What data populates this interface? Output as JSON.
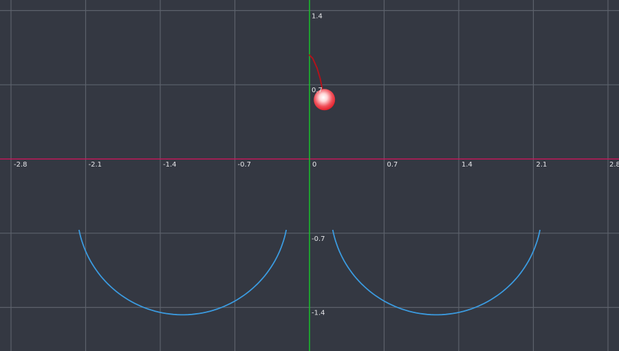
{
  "graph": {
    "colors": {
      "background": "#343842",
      "grid": "#5d626c",
      "x_axis": "#c2185b",
      "y_axis": "#18c12b",
      "curve": "#3b9be0",
      "trail": "#b3121b",
      "ball_center": "#ffffff",
      "ball_edge": "#e3202b"
    },
    "x_ticks": [
      {
        "value": -2.8,
        "label": "-2.8"
      },
      {
        "value": -2.1,
        "label": "-2.1"
      },
      {
        "value": -1.4,
        "label": "-1.4"
      },
      {
        "value": -0.7,
        "label": "-0.7"
      },
      {
        "value": 0,
        "label": "0"
      },
      {
        "value": 0.7,
        "label": "0.7"
      },
      {
        "value": 1.4,
        "label": "1.4"
      },
      {
        "value": 2.1,
        "label": "2.1"
      },
      {
        "value": 2.8,
        "label": "2.8"
      }
    ],
    "y_ticks": [
      {
        "value": 1.4,
        "label": "1.4"
      },
      {
        "value": 0.7,
        "label": "0.7"
      },
      {
        "value": -0.7,
        "label": "-0.7"
      },
      {
        "value": -1.4,
        "label": "-1.4"
      }
    ],
    "semicircles": [
      {
        "center_x": -1.19,
        "center_y": -0.48,
        "radius": 0.99,
        "start_angle_deg": 191,
        "end_angle_deg": 349
      },
      {
        "center_x": 1.19,
        "center_y": -0.48,
        "radius": 0.99,
        "start_angle_deg": 191,
        "end_angle_deg": 349
      }
    ],
    "ball": {
      "x": 0.14,
      "y": 0.56,
      "radius": 0.1
    },
    "trail": [
      [
        0,
        0.98
      ],
      [
        0.03,
        0.95
      ],
      [
        0.07,
        0.86
      ],
      [
        0.1,
        0.76
      ],
      [
        0.12,
        0.66
      ],
      [
        0.14,
        0.56
      ]
    ]
  }
}
